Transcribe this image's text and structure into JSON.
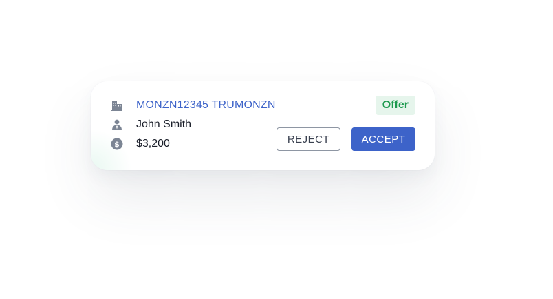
{
  "offer_card": {
    "load_number": "MONZN12345 TRUMONZN",
    "contact_name": "John Smith",
    "price": "$3,200",
    "status_badge": "Offer",
    "reject_label": "REJECT",
    "accept_label": "ACCEPT",
    "icons": {
      "facility": "building-icon",
      "contact": "person-icon",
      "price": "dollar-circle-icon"
    }
  },
  "colors": {
    "link_blue": "#3d63c9",
    "badge_green_text": "#1f9a4f",
    "badge_green_bg": "#e6f5ec",
    "icon_gray": "#7c8594",
    "accept_bg": "#3d63c9"
  }
}
